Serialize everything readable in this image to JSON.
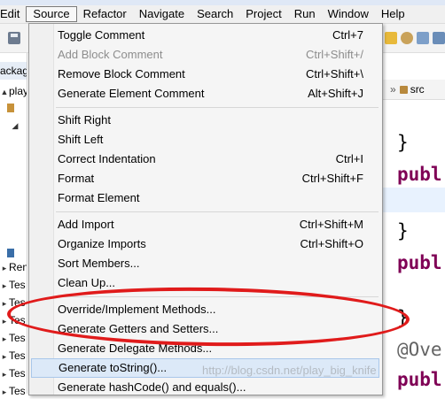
{
  "menubar": {
    "items": [
      "Edit",
      "Source",
      "Refactor",
      "Navigate",
      "Search",
      "Project",
      "Run",
      "Window",
      "Help"
    ]
  },
  "left_panel": {
    "tab_label": "ackag",
    "rows": [
      "play",
      "Ren",
      "Tes",
      "Tes",
      "Tes",
      "Tes",
      "Tes",
      "Tes",
      "Tes"
    ]
  },
  "editor": {
    "breadcrumb": "src",
    "code_lines": [
      "}",
      "publ",
      "}",
      "publ",
      "}",
      "@Ove",
      "publ"
    ]
  },
  "source_menu": {
    "groups": [
      [
        {
          "label": "Toggle Comment",
          "accel": "Ctrl+7",
          "enabled": true
        },
        {
          "label": "Add Block Comment",
          "accel": "Ctrl+Shift+/",
          "enabled": false
        },
        {
          "label": "Remove Block Comment",
          "accel": "Ctrl+Shift+\\",
          "enabled": true
        },
        {
          "label": "Generate Element Comment",
          "accel": "Alt+Shift+J",
          "enabled": true
        }
      ],
      [
        {
          "label": "Shift Right",
          "accel": "",
          "enabled": true
        },
        {
          "label": "Shift Left",
          "accel": "",
          "enabled": true
        },
        {
          "label": "Correct Indentation",
          "accel": "Ctrl+I",
          "enabled": true
        },
        {
          "label": "Format",
          "accel": "Ctrl+Shift+F",
          "enabled": true
        },
        {
          "label": "Format Element",
          "accel": "",
          "enabled": true
        }
      ],
      [
        {
          "label": "Add Import",
          "accel": "Ctrl+Shift+M",
          "enabled": true
        },
        {
          "label": "Organize Imports",
          "accel": "Ctrl+Shift+O",
          "enabled": true
        },
        {
          "label": "Sort Members...",
          "accel": "",
          "enabled": true
        },
        {
          "label": "Clean Up...",
          "accel": "",
          "enabled": true
        }
      ],
      [
        {
          "label": "Override/Implement Methods...",
          "accel": "",
          "enabled": true
        },
        {
          "label": "Generate Getters and Setters...",
          "accel": "",
          "enabled": true
        },
        {
          "label": "Generate Delegate Methods...",
          "accel": "",
          "enabled": true
        },
        {
          "label": "Generate toString()...",
          "accel": "",
          "enabled": true
        },
        {
          "label": "Generate hashCode() and equals()...",
          "accel": "",
          "enabled": true
        }
      ]
    ]
  },
  "watermark": "http://blog.csdn.net/play_big_knife",
  "colors": {
    "annotation_red": "#e01b1b",
    "keyword": "#7f0055",
    "hover_highlight": "#dce9f8"
  }
}
